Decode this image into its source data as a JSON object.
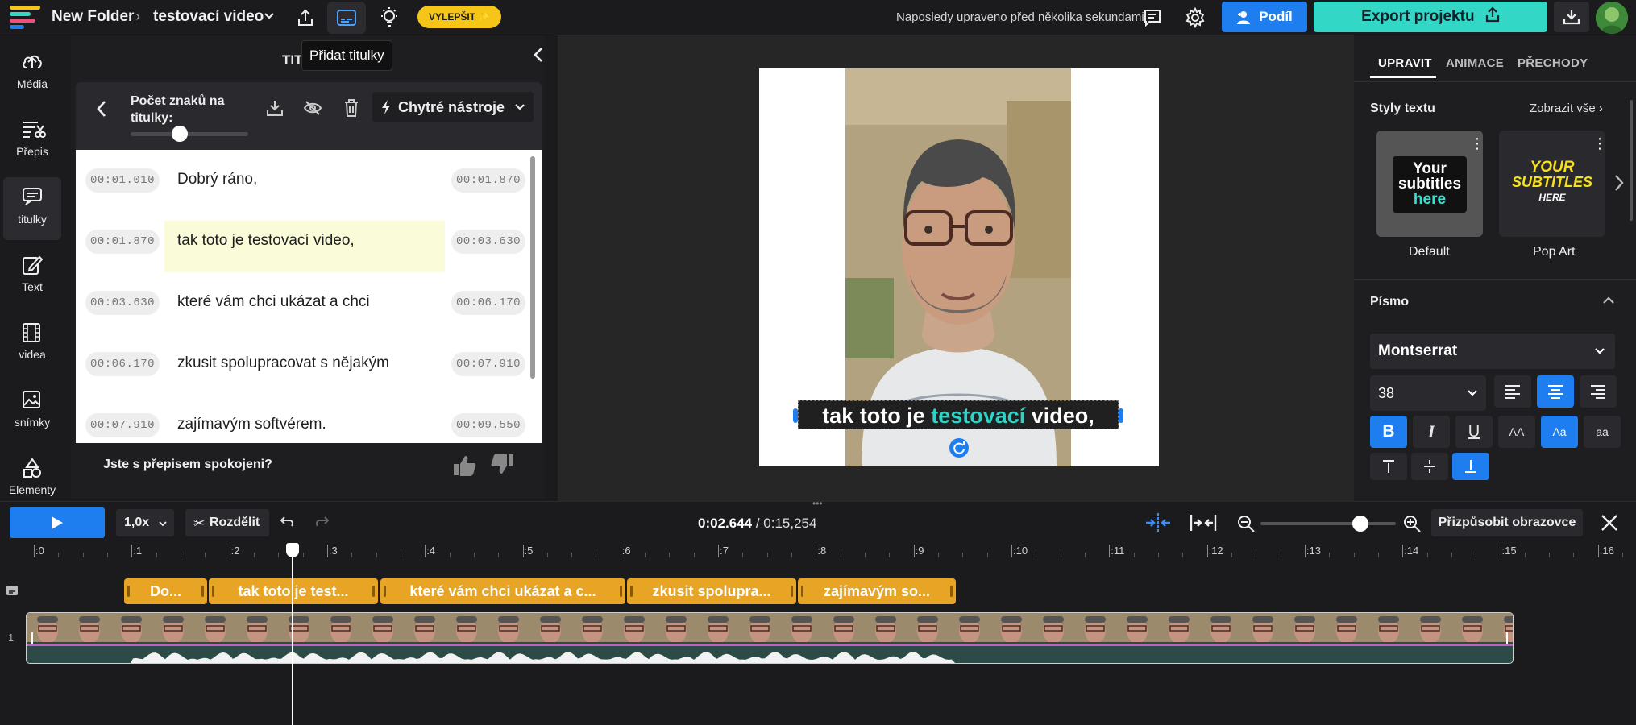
{
  "topbar": {
    "folder": "New Folder",
    "project": "testovací video",
    "tooltip": "Přidat titulky",
    "upgrade": "VYLEPŠIT ✨",
    "saved_status": "Naposledy upraveno před několika sekundami",
    "share": "Podíl",
    "export": "Export projektu"
  },
  "leftnav": {
    "items": [
      {
        "label": "Média",
        "icon": "upload-icon"
      },
      {
        "label": "Přepis",
        "icon": "transcript-icon"
      },
      {
        "label": "titulky",
        "icon": "subtitles-icon"
      },
      {
        "label": "Text",
        "icon": "text-edit-icon"
      },
      {
        "label": "videa",
        "icon": "film-icon"
      },
      {
        "label": "snímky",
        "icon": "image-icon"
      },
      {
        "label": "Elementy",
        "icon": "shapes-icon"
      }
    ]
  },
  "subpanel": {
    "title_partial": "TIT",
    "char_count_label": "Počet znaků na titulky:",
    "char_slider_fraction": 0.42,
    "smart_tools": "Chytré nástroje",
    "rows": [
      {
        "start": "00:01.010",
        "end": "00:01.870",
        "text": "Dobrý ráno,"
      },
      {
        "start": "00:01.870",
        "end": "00:03.630",
        "text": "tak toto je testovací video,"
      },
      {
        "start": "00:03.630",
        "end": "00:06.170",
        "text": "které vám chci ukázat a chci"
      },
      {
        "start": "00:06.170",
        "end": "00:07.910",
        "text": "zkusit spolupracovat s nějakým"
      },
      {
        "start": "00:07.910",
        "end": "00:09.550",
        "text": "zajímavým softvérem."
      }
    ],
    "feedback": "Jste s přepisem spokojeni?"
  },
  "preview": {
    "caption_before": "tak toto je ",
    "caption_highlight": "testovací",
    "caption_after": " video,",
    "highlight_color": "#2ed3c6"
  },
  "rightpanel": {
    "tabs": [
      "UPRAVIT",
      "ANIMACE",
      "PŘECHODY"
    ],
    "styles_heading": "Styly textu",
    "show_all": "Zobrazit vše",
    "style_cards": [
      {
        "name": "Default",
        "preview_lines": [
          "Your",
          "subtitles",
          "here"
        ]
      },
      {
        "name": "Pop Art",
        "preview_lines": [
          "YOUR",
          "SUBTITLES",
          "HERE"
        ]
      }
    ],
    "font_heading": "Písmo",
    "font_name": "Montserrat",
    "font_size": "38",
    "case_options": [
      "AA",
      "Aa",
      "aa"
    ]
  },
  "timeline": {
    "speed": "1,0x",
    "split": "Rozdělit",
    "current_time": "0:02.644",
    "total_time": "0:15,254",
    "fit_screen": "Přizpůsobit obrazovce",
    "zoom_fraction": 0.74,
    "ruler": [
      ":0",
      ":1",
      ":2",
      ":3",
      ":4",
      ":5",
      ":6",
      ":7",
      ":8",
      ":9",
      ":10",
      ":11",
      ":12",
      ":13",
      ":14",
      ":15",
      ":16"
    ],
    "playhead_seconds": 2.644,
    "clips": [
      {
        "label": "Do..."
      },
      {
        "label": "tak toto je test..."
      },
      {
        "label": "které vám chci ukázat a c..."
      },
      {
        "label": "zkusit spolupra..."
      },
      {
        "label": "zajímavým so..."
      }
    ],
    "track_number": "1"
  }
}
